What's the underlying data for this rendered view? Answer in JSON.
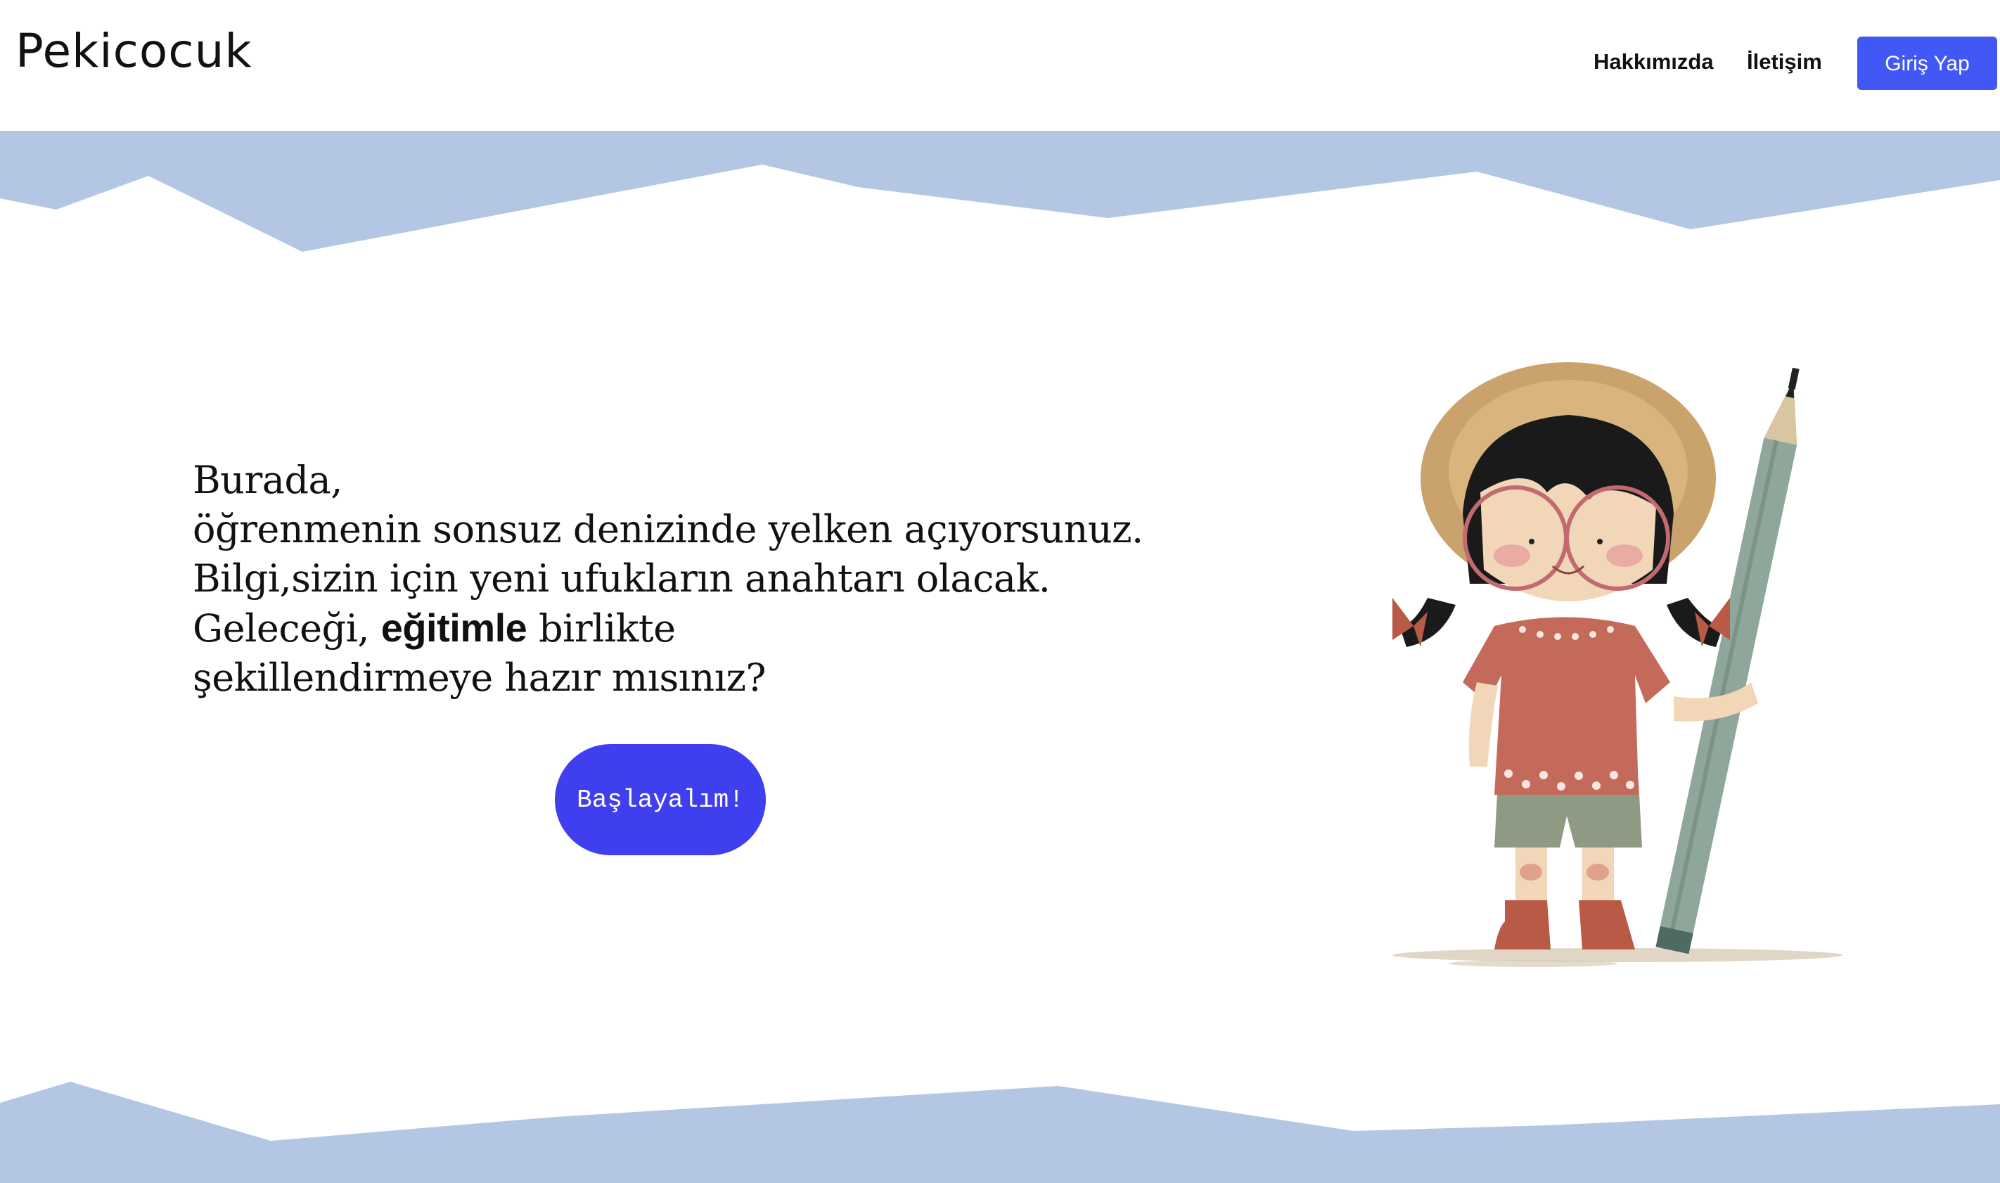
{
  "navbar": {
    "logo_text": "Pekicocuk",
    "links": [
      {
        "label": "Hakkımızda"
      },
      {
        "label": "İletişim"
      }
    ],
    "login_label": "Giriş Yap"
  },
  "hero": {
    "line1": "Burada,",
    "line2": "öğrenmenin sonsuz denizinde yelken açıyorsunuz.",
    "line3": "Bilgi,sizin için yeni ufukların anahtarı olacak.",
    "line4_before": "Geleceği, ",
    "line4_strong": "eğitimle",
    "line4_after": " birlikte",
    "line5": "şekillendirmeye hazır mısınız?",
    "cta_label": "Başlayalım!"
  },
  "colors": {
    "accent": "#4158f6",
    "cta": "#3f3ff0",
    "wave": "#b3c7e5"
  }
}
